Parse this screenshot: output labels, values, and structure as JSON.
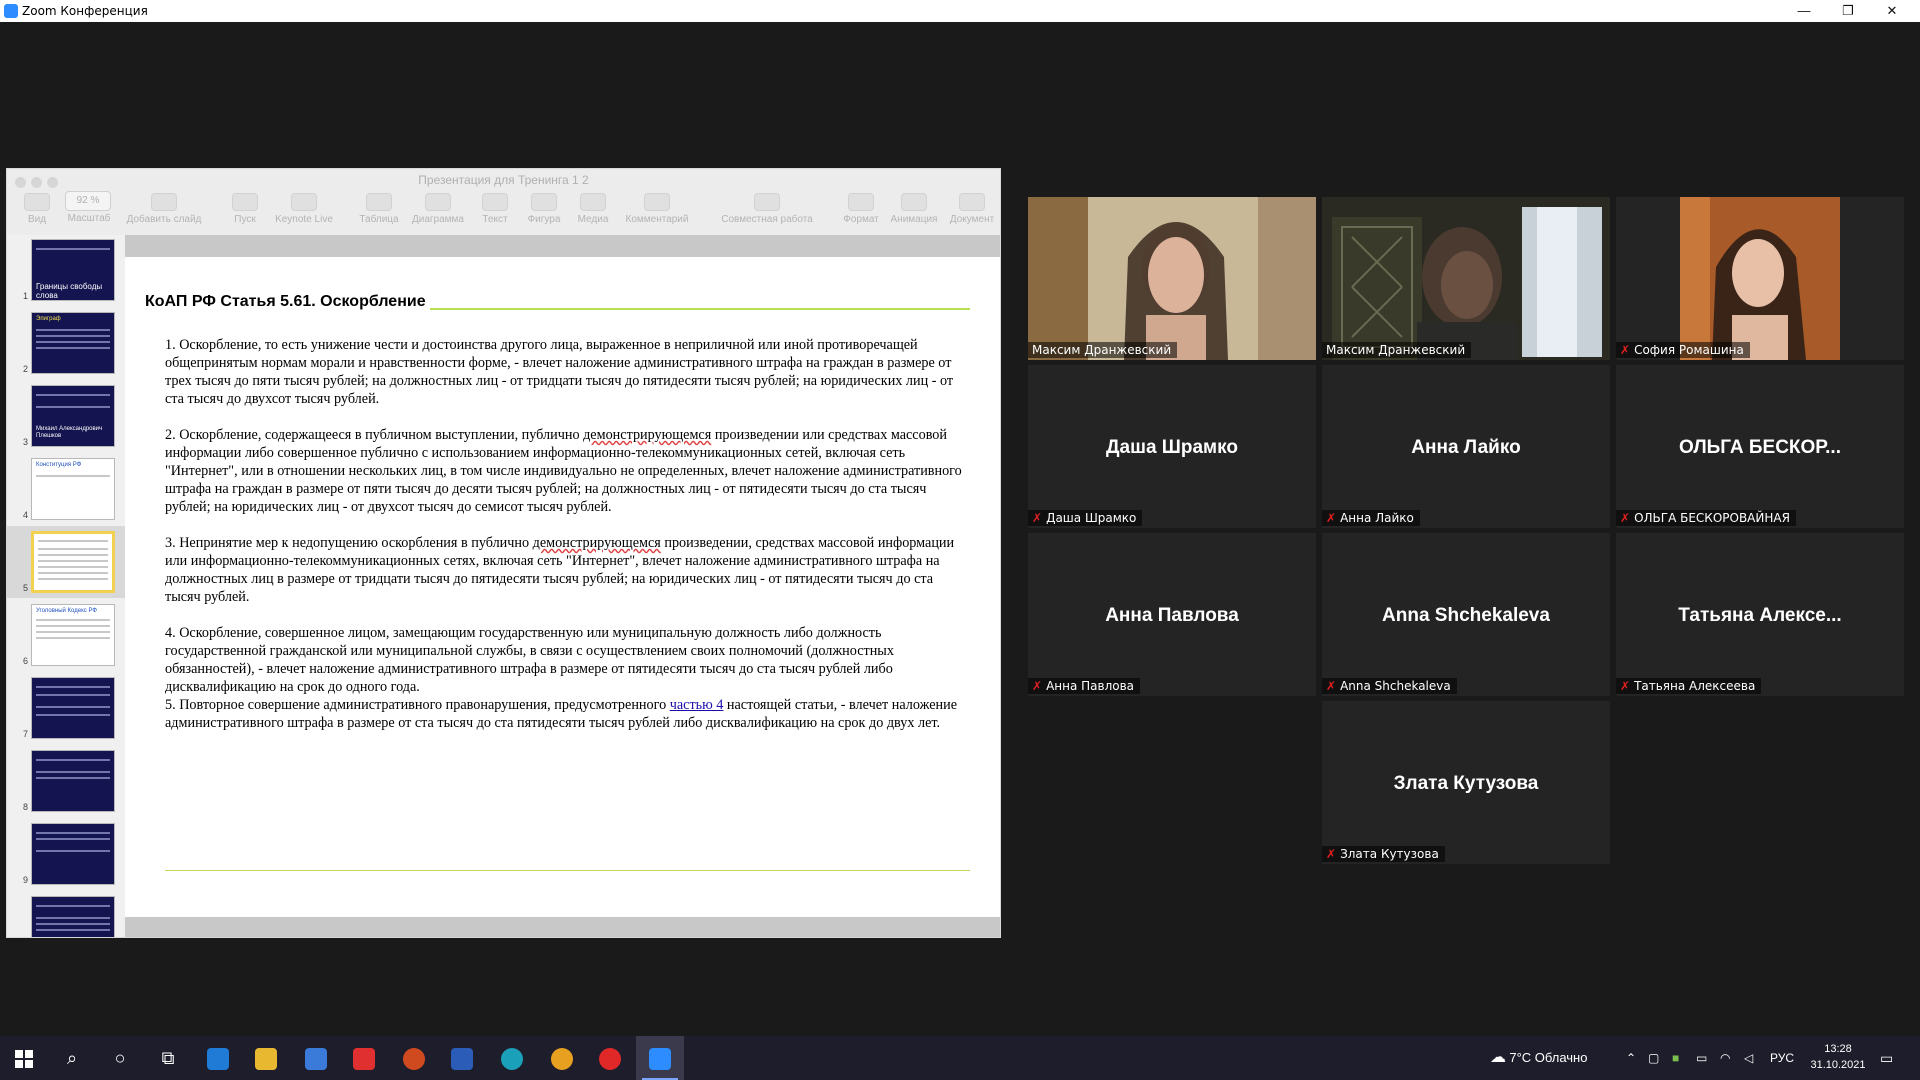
{
  "window": {
    "title": "Zoom Конференция",
    "controls": [
      "—",
      "❐",
      "✕"
    ]
  },
  "keynote": {
    "title": "Презентация для Тренинга 1 2",
    "zoom": "92 %",
    "tools": [
      {
        "label": "Вид",
        "icon": "view-icon"
      },
      {
        "label": "Масштаб",
        "icon": "zoom-icon"
      },
      {
        "label": "Добавить слайд",
        "icon": "add-slide-icon"
      },
      {
        "label": "Пуск",
        "icon": "play-icon"
      },
      {
        "label": "Keynote Live",
        "icon": "keynote-live-icon"
      },
      {
        "label": "Таблица",
        "icon": "table-icon"
      },
      {
        "label": "Диаграмма",
        "icon": "chart-icon"
      },
      {
        "label": "Текст",
        "icon": "text-icon"
      },
      {
        "label": "Фигура",
        "icon": "shape-icon"
      },
      {
        "label": "Медиа",
        "icon": "media-icon"
      },
      {
        "label": "Комментарий",
        "icon": "comment-icon"
      },
      {
        "label": "Совместная работа",
        "icon": "collaborate-icon"
      },
      {
        "label": "Формат",
        "icon": "format-icon"
      },
      {
        "label": "Анимация",
        "icon": "animate-icon"
      },
      {
        "label": "Документ",
        "icon": "document-icon"
      }
    ],
    "thumbnails": [
      {
        "num": "1",
        "style": "dark",
        "title": "Границы свободы слова"
      },
      {
        "num": "2",
        "style": "dark",
        "title": "Эпиграф"
      },
      {
        "num": "3",
        "style": "dark",
        "title": "Михаил Александрович Плешков"
      },
      {
        "num": "4",
        "style": "light",
        "title": "Конституция РФ"
      },
      {
        "num": "5",
        "style": "light",
        "title": "",
        "selected": true
      },
      {
        "num": "6",
        "style": "light",
        "title": "Уголовный Кодекс РФ"
      },
      {
        "num": "7",
        "style": "dark",
        "title": ""
      },
      {
        "num": "8",
        "style": "dark",
        "title": ""
      },
      {
        "num": "9",
        "style": "dark",
        "title": ""
      },
      {
        "num": "",
        "style": "dark",
        "title": ""
      }
    ],
    "slide": {
      "title": "КоАП РФ Статья 5.61. Оскорбление",
      "p1": "1. Оскорбление, то есть унижение чести и достоинства другого лица, выраженное в неприличной или иной противоречащей общепринятым нормам морали и нравственности форме, - влечет наложение административного штрафа на граждан в размере от трех тысяч до пяти тысяч рублей; на должностных лиц - от тридцати тысяч до пятидесяти тысяч рублей; на юридических лиц - от ста тысяч до двухсот тысяч рублей.",
      "p2_a": "2. Оскорбление, содержащееся в публичном выступлении, публично ",
      "p2_u": "демонстрирующемся",
      "p2_b": " произведении или средствах массовой информации либо совершенное публично с использованием информационно-телекоммуникационных сетей, включая сеть \"Интернет\", или в отношении нескольких лиц, в том числе индивидуально не определенных, влечет наложение административного штрафа на граждан в размере от пяти тысяч до десяти тысяч рублей; на должностных лиц - от пятидесяти тысяч до ста тысяч рублей; на юридических лиц - от двухсот тысяч до семисот тысяч рублей.",
      "p3_a": "3. Непринятие мер к недопущению оскорбления в публично ",
      "p3_u": "демонстрирующемся",
      "p3_b": " произведении, средствах массовой информации или информационно-телекоммуникационных сетях, включая сеть \"Интернет\", влечет наложение административного штрафа на должностных лиц в размере от тридцати тысяч до пятидесяти тысяч рублей; на юридических лиц - от пятидесяти тысяч до ста тысяч рублей.",
      "p4": "4. Оскорбление, совершенное лицом, замещающим государственную или муниципальную должность либо должность государственной гражданской или муниципальной службы, в связи с осуществлением своих полномочий (должностных обязанностей), - влечет наложение административного штрафа в размере от пятидесяти тысяч до ста тысяч рублей либо дисквалификацию на срок до одного года.",
      "p5_a": "5. Повторное совершение административного правонарушения, предусмотренного ",
      "p5_link": "частью 4",
      "p5_b": " настоящей статьи, - влечет наложение административного штрафа в размере от ста тысяч до ста пятидесяти тысяч рублей либо дисквалификацию на срок до двух лет."
    }
  },
  "participants": [
    {
      "display": "",
      "tag": "Максим Дранжевский",
      "video": true,
      "muted": false,
      "active": false
    },
    {
      "display": "",
      "tag": "Максим Дранжевский",
      "video": true,
      "muted": false,
      "active": true
    },
    {
      "display": "",
      "tag": "София Ромашина",
      "video": true,
      "muted": true,
      "active": false
    },
    {
      "display": "Даша Шрамко",
      "tag": "Даша Шрамко",
      "video": false,
      "muted": true
    },
    {
      "display": "Анна Лайко",
      "tag": "Анна Лайко",
      "video": false,
      "muted": true
    },
    {
      "display": "ОЛЬГА  БЕСКОР...",
      "tag": "ОЛЬГА БЕСКОРОВАЙНАЯ",
      "video": false,
      "muted": true
    },
    {
      "display": "Анна Павлова",
      "tag": "Анна Павлова",
      "video": false,
      "muted": true
    },
    {
      "display": "Anna Shchekaleva",
      "tag": "Anna Shchekaleva",
      "video": false,
      "muted": true
    },
    {
      "display": "Татьяна  Алексе...",
      "tag": "Татьяна Алексеева",
      "video": false,
      "muted": true
    },
    {
      "display": "Злата Кутузова",
      "tag": "Злата Кутузова",
      "video": false,
      "muted": true
    }
  ],
  "taskbar": {
    "weather": "7°C  Облачно",
    "lang": "РУС",
    "time": "13:28",
    "date": "31.10.2021",
    "apps": [
      "start-icon",
      "search-icon",
      "cortana-icon",
      "task-view-icon",
      "ie-icon",
      "explorer-icon",
      "mail-icon",
      "yandex-icon",
      "powerpoint-icon",
      "word-icon",
      "edge-icon",
      "chrome-icon",
      "yandex-browser-icon",
      "zoom-icon"
    ]
  },
  "colors": {
    "active_speaker": "#c8e060",
    "muted_mic": "#e02020",
    "slide_rule": "#b8e050",
    "zoom_blue": "#2d8cff"
  }
}
